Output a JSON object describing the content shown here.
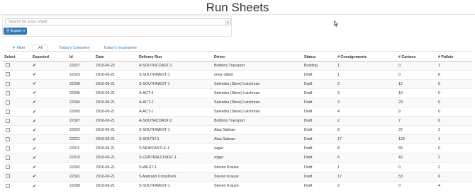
{
  "header": {
    "title": "Run Sheets"
  },
  "search": {
    "placeholder": "Search for a run sheet",
    "dropdown_icon": "chevron-down-icon"
  },
  "export": {
    "label": "Export",
    "icon": "file-icon",
    "caret": "caret-down-icon"
  },
  "filter": {
    "label": "Filter",
    "icon": "filter-icon"
  },
  "tabs": [
    {
      "label": "All",
      "active": true
    },
    {
      "label": "Today's Complete",
      "active": false
    },
    {
      "label": "Today's Incomplete",
      "active": false
    }
  ],
  "table": {
    "columns": [
      "Select",
      "Exported",
      "Id",
      "Date",
      "Delivery Run",
      "Driver",
      "Status",
      "# Consignments",
      "# Cartons",
      "# Pallets"
    ],
    "rows": [
      {
        "exported": "✔",
        "id": "22327",
        "date": "2016-06-22",
        "run": "A-SOUTHCOAST-1",
        "driver": "Bobbins Transport",
        "status": "Building",
        "consignments": "1",
        "cartons": "0",
        "pallets": "1"
      },
      {
        "exported": "✔",
        "id": "22323",
        "date": "2016-06-21",
        "run": "S-SOUTHWEST-1",
        "driver": "omar obeid",
        "status": "Draft",
        "consignments": "1",
        "cartons": "0",
        "pallets": "8"
      },
      {
        "exported": "✔",
        "id": "22306",
        "date": "2016-06-21",
        "run": "S-SOUTHWEST-1",
        "driver": "Salendra (Steve) Latchman",
        "status": "Draft",
        "consignments": "3",
        "cartons": "12",
        "pallets": "0"
      },
      {
        "exported": "✔",
        "id": "22305",
        "date": "2016-06-21",
        "run": "A-ACT-3",
        "driver": "Salendra (Steve) Latchman",
        "status": "Draft",
        "consignments": "3",
        "cartons": "10",
        "pallets": "0"
      },
      {
        "exported": "✔",
        "id": "22304",
        "date": "2016-06-21",
        "run": "A-ACT-2",
        "driver": "Salendra (Steve) Latchman",
        "status": "Draft",
        "consignments": "3",
        "cartons": "23",
        "pallets": "0"
      },
      {
        "exported": "✔",
        "id": "22303",
        "date": "2016-06-21",
        "run": "A-ACT-1",
        "driver": "Salendra (Steve) Latchman",
        "status": "Draft",
        "consignments": "4",
        "cartons": "9",
        "pallets": "0"
      },
      {
        "exported": "✔",
        "id": "22307",
        "date": "2016-06-21",
        "run": "A-SOUTHCOAST-2",
        "driver": "Bobbins Transport",
        "status": "Draft",
        "consignments": "2",
        "cartons": "7",
        "pallets": "0"
      },
      {
        "exported": "✔",
        "id": "22322",
        "date": "2016-06-21",
        "run": "S-SOUTHWEST-1",
        "driver": "Alaa Salman",
        "status": "Draft",
        "consignments": "8",
        "cartons": "37",
        "pallets": "2"
      },
      {
        "exported": "✔",
        "id": "22321",
        "date": "2016-06-21",
        "run": "S-SOUTH-1",
        "driver": "Alaa Salman",
        "status": "Draft",
        "consignments": "17",
        "cartons": "123",
        "pallets": "1"
      },
      {
        "exported": "✔",
        "id": "22311",
        "date": "2016-06-21",
        "run": "S-NEWCASTLE-1",
        "driver": "ozgur",
        "status": "Draft",
        "consignments": "8",
        "cartons": "55",
        "pallets": "0"
      },
      {
        "exported": "✔",
        "id": "22310",
        "date": "2016-06-21",
        "run": "S-CENTRALCOAST-1",
        "driver": "ozgur",
        "status": "Draft",
        "consignments": "6",
        "cartons": "42",
        "pallets": "2"
      },
      {
        "exported": "✔",
        "id": "22302",
        "date": "2016-06-21",
        "run": "S-WEST-1",
        "driver": "Steven Krause",
        "status": "Draft",
        "consignments": "1",
        "cartons": "0",
        "pallets": "2"
      },
      {
        "exported": "✔",
        "id": "22301",
        "date": "2016-06-21",
        "run": "S-Metcash CrossDock",
        "driver": "Steven Krause",
        "status": "Draft",
        "consignments": "17",
        "cartons": "53",
        "pallets": "0"
      },
      {
        "exported": "✔",
        "id": "22300",
        "date": "2016-06-21",
        "run": "S-SOUTHWEST-1",
        "driver": "Steven Krause",
        "status": "Draft",
        "consignments": "2",
        "cartons": "0",
        "pallets": "4"
      }
    ]
  },
  "colors": {
    "link": "#337ab7",
    "button": "#337ab7",
    "stripe": "#f9f9f9"
  }
}
